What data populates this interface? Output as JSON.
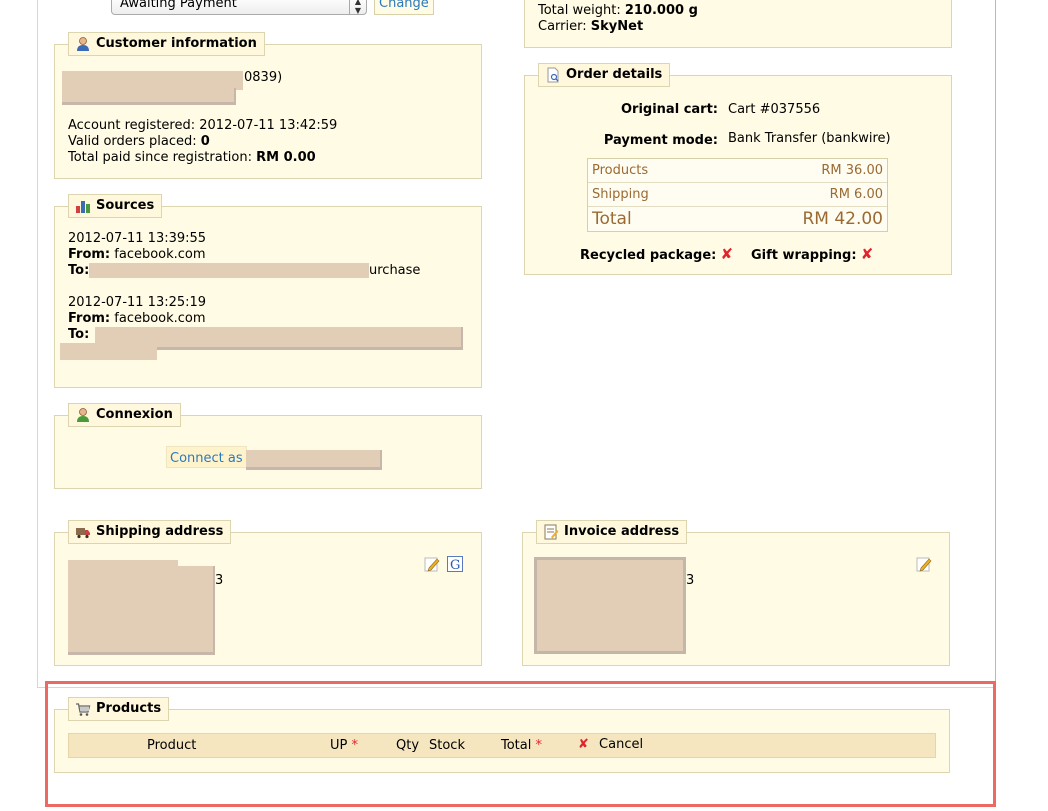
{
  "order_status": {
    "selected": "Awaiting Payment",
    "change_label": "Change"
  },
  "shipping_summary": {
    "weight_label": "Total weight:",
    "weight_value": "210.000 g",
    "carrier_label": "Carrier:",
    "carrier_value": "SkyNet"
  },
  "customer": {
    "title": "Customer information",
    "name_suffix": "0839)",
    "account_registered_label": "Account registered:",
    "account_registered_value": "2012-07-11 13:42:59",
    "valid_orders_label": "Valid orders placed:",
    "valid_orders_value": "0",
    "total_paid_label": "Total paid since registration:",
    "total_paid_value": "RM 0.00"
  },
  "sources": {
    "title": "Sources",
    "entries": [
      {
        "date": "2012-07-11 13:39:55",
        "from_label": "From:",
        "from_value": "facebook.com",
        "to_label": "To:",
        "to_tail": "urchase"
      },
      {
        "date": "2012-07-11 13:25:19",
        "from_label": "From:",
        "from_value": "facebook.com",
        "to_label": "To:",
        "to_tail": ""
      }
    ]
  },
  "connexion": {
    "title": "Connexion",
    "connect_label": "Connect as"
  },
  "order_details": {
    "title": "Order details",
    "original_cart_label": "Original cart:",
    "original_cart_value": "Cart #037556",
    "payment_mode_label": "Payment mode:",
    "payment_mode_value": "Bank Transfer (bankwire)",
    "products_label": "Products",
    "products_value": "RM 36.00",
    "shipping_label": "Shipping",
    "shipping_value": "RM 6.00",
    "total_label": "Total",
    "total_value": "RM 42.00",
    "recycled_label": "Recycled package:",
    "gift_label": "Gift wrapping:"
  },
  "shipping_address": {
    "title": "Shipping address",
    "digit": "3"
  },
  "invoice_address": {
    "title": "Invoice address",
    "digit": "3"
  },
  "products": {
    "title": "Products",
    "columns": {
      "product": "Product",
      "up": "UP",
      "qty": "Qty",
      "stock": "Stock",
      "total": "Total",
      "cancel": "Cancel"
    },
    "required_mark": "*"
  },
  "colors": {
    "link": "#2a7ac0",
    "panel_bg": "#fffbe4",
    "panel_border": "#ddd5b0",
    "amount": "#9a6a32",
    "highlight": "#ec6a63",
    "cancel_red": "#e0242c"
  }
}
